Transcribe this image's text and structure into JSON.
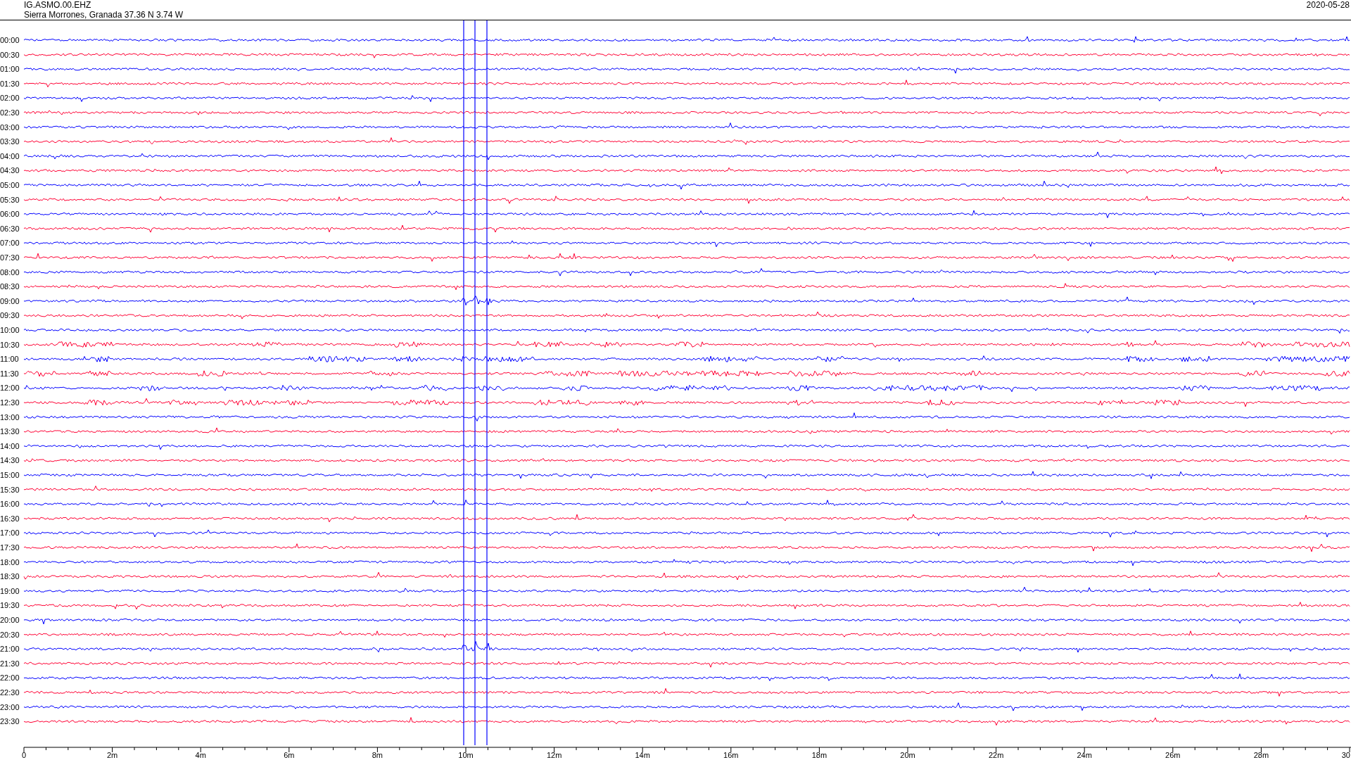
{
  "header": {
    "station": "IG.ASMO.00.EHZ",
    "location": "Sierra Morrones, Granada  37.36 N 3.74 W",
    "date": "2020-05-28"
  },
  "rows": [
    {
      "label": "00:00",
      "color": "#0000ff"
    },
    {
      "label": "00:30",
      "color": "#ff0033"
    },
    {
      "label": "01:00",
      "color": "#0000ff"
    },
    {
      "label": "01:30",
      "color": "#ff0033"
    },
    {
      "label": "02:00",
      "color": "#0000ff"
    },
    {
      "label": "02:30",
      "color": "#ff0033"
    },
    {
      "label": "03:00",
      "color": "#0000ff"
    },
    {
      "label": "03:30",
      "color": "#ff0033"
    },
    {
      "label": "04:00",
      "color": "#0000ff"
    },
    {
      "label": "04:30",
      "color": "#ff0033"
    },
    {
      "label": "05:00",
      "color": "#0000ff"
    },
    {
      "label": "05:30",
      "color": "#ff0033"
    },
    {
      "label": "06:00",
      "color": "#0000ff"
    },
    {
      "label": "06:30",
      "color": "#ff0033"
    },
    {
      "label": "07:00",
      "color": "#0000ff"
    },
    {
      "label": "07:30",
      "color": "#ff0033"
    },
    {
      "label": "08:00",
      "color": "#0000ff"
    },
    {
      "label": "08:30",
      "color": "#ff0033"
    },
    {
      "label": "09:00",
      "color": "#0000ff"
    },
    {
      "label": "09:30",
      "color": "#ff0033"
    },
    {
      "label": "10:00",
      "color": "#0000ff"
    },
    {
      "label": "10:30",
      "color": "#ff0033"
    },
    {
      "label": "11:00",
      "color": "#0000ff"
    },
    {
      "label": "11:30",
      "color": "#ff0033"
    },
    {
      "label": "12:00",
      "color": "#0000ff"
    },
    {
      "label": "12:30",
      "color": "#ff0033"
    },
    {
      "label": "13:00",
      "color": "#0000ff"
    },
    {
      "label": "13:30",
      "color": "#ff0033"
    },
    {
      "label": "14:00",
      "color": "#0000ff"
    },
    {
      "label": "14:30",
      "color": "#ff0033"
    },
    {
      "label": "15:00",
      "color": "#0000ff"
    },
    {
      "label": "15:30",
      "color": "#ff0033"
    },
    {
      "label": "16:00",
      "color": "#0000ff"
    },
    {
      "label": "16:30",
      "color": "#ff0033"
    },
    {
      "label": "17:00",
      "color": "#0000ff"
    },
    {
      "label": "17:30",
      "color": "#ff0033"
    },
    {
      "label": "18:00",
      "color": "#0000ff"
    },
    {
      "label": "18:30",
      "color": "#ff0033"
    },
    {
      "label": "19:00",
      "color": "#0000ff"
    },
    {
      "label": "19:30",
      "color": "#ff0033"
    },
    {
      "label": "20:00",
      "color": "#0000ff"
    },
    {
      "label": "20:30",
      "color": "#ff0033"
    },
    {
      "label": "21:00",
      "color": "#0000ff"
    },
    {
      "label": "21:30",
      "color": "#ff0033"
    },
    {
      "label": "22:00",
      "color": "#0000ff"
    },
    {
      "label": "22:30",
      "color": "#ff0033"
    },
    {
      "label": "23:00",
      "color": "#0000ff"
    },
    {
      "label": "23:30",
      "color": "#ff0033"
    }
  ],
  "x_axis": {
    "labels": [
      "0",
      "2m",
      "4m",
      "6m",
      "8m",
      "10m",
      "12m",
      "14m",
      "16m",
      "18m",
      "20m",
      "22m",
      "24m",
      "26m",
      "28m",
      "30"
    ]
  }
}
